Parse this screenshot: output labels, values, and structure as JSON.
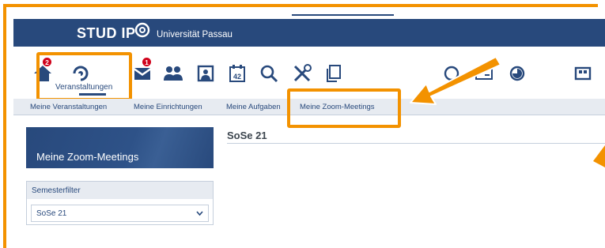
{
  "header": {
    "logo_text": "STUD IP",
    "university": "Universität Passau"
  },
  "nav": {
    "items": [
      {
        "name": "start",
        "badge": "2"
      },
      {
        "name": "veranstaltungen",
        "label": "Veranstaltungen"
      },
      {
        "name": "nachrichten",
        "badge": "1"
      },
      {
        "name": "community"
      },
      {
        "name": "profil"
      },
      {
        "name": "planer",
        "day": "42"
      },
      {
        "name": "suche"
      },
      {
        "name": "tools"
      },
      {
        "name": "dateien"
      },
      {
        "name": "weitere-1"
      },
      {
        "name": "weitere-2"
      },
      {
        "name": "weitere-3"
      },
      {
        "name": "weitere-4"
      }
    ]
  },
  "subtabs": [
    {
      "label": "Meine Veranstaltungen"
    },
    {
      "label": "Meine Einrichtungen"
    },
    {
      "label": "Meine Aufgaben"
    },
    {
      "label": "Meine Zoom-Meetings"
    }
  ],
  "sidebar": {
    "title": "Meine Zoom-Meetings",
    "filter": {
      "title": "Semesterfilter",
      "selected": "SoSe 21"
    }
  },
  "main": {
    "title": "SoSe 21"
  },
  "colors": {
    "brand": "#28497c",
    "highlight": "#f39200",
    "badge": "#d0021b",
    "tab_bg": "#e7ebf1"
  }
}
